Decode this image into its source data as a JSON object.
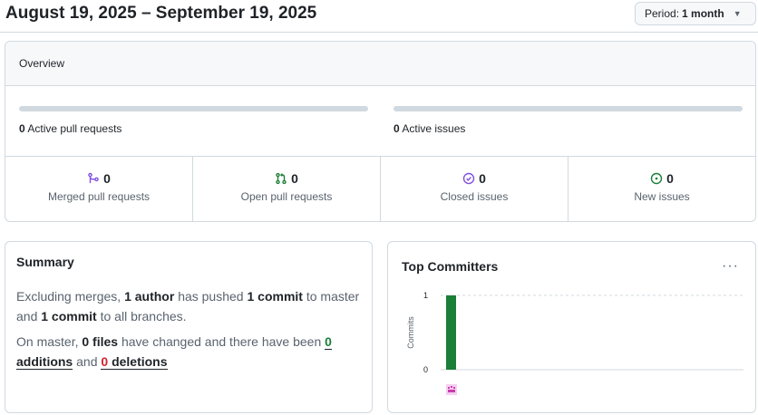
{
  "header": {
    "date_range": "August 19, 2025 – September 19, 2025",
    "period_label": "Period:",
    "period_value": "1 month"
  },
  "overview": {
    "title": "Overview",
    "active_prs": {
      "count": "0",
      "label": "Active pull requests",
      "fill": 0
    },
    "active_issues": {
      "count": "0",
      "label": "Active issues",
      "fill": 0
    },
    "stats": [
      {
        "icon": "merge-icon",
        "value": "0",
        "label": "Merged pull requests",
        "color": "#8250df"
      },
      {
        "icon": "pull-request-icon",
        "value": "0",
        "label": "Open pull requests",
        "color": "#1a7f37"
      },
      {
        "icon": "issue-closed-icon",
        "value": "0",
        "label": "Closed issues",
        "color": "#8250df"
      },
      {
        "icon": "issue-opened-icon",
        "value": "0",
        "label": "New issues",
        "color": "#1a7f37"
      }
    ]
  },
  "summary": {
    "title": "Summary",
    "p1_a": "Excluding merges,",
    "p1_authors": "1 author",
    "p1_b": "has pushed",
    "p1_commits": "1 commit",
    "p1_c": "to master and",
    "p1_commits_all": "1 commit",
    "p1_d": "to all branches.",
    "p2_a": "On master,",
    "p2_files": "0 files",
    "p2_b": "have changed and there have been",
    "p2_add_num": "0",
    "p2_add": "additions",
    "p2_and": "and",
    "p2_del_num": "0",
    "p2_del": "deletions"
  },
  "committers": {
    "title": "Top Committers",
    "menu": "···",
    "avatar_icon": "avatar-icon"
  },
  "chart_data": {
    "type": "bar",
    "categories": [
      "committer-1"
    ],
    "values": [
      1
    ],
    "ylabel": "Commits",
    "ylim": [
      0,
      1
    ],
    "yticks": [
      "0",
      "1"
    ],
    "bar_color": "#1a7f37"
  }
}
